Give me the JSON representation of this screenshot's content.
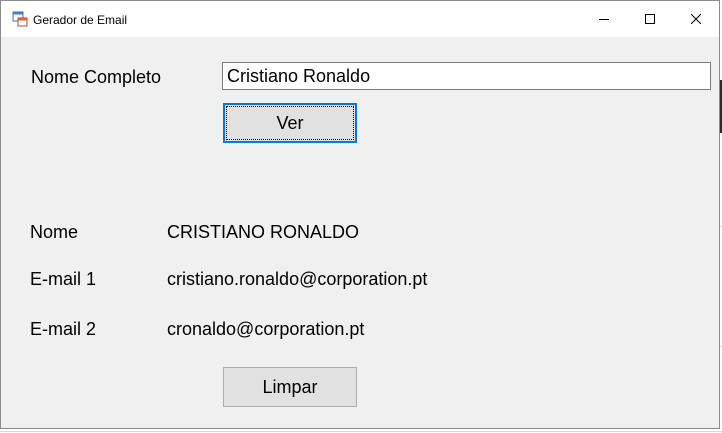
{
  "window": {
    "title": "Gerador de Email",
    "controls": [
      "minimize-icon",
      "maximize-icon",
      "close-icon"
    ]
  },
  "form": {
    "full_name_label": "Nome Completo",
    "full_name_value": "Cristiano Ronaldo",
    "view_button": "Ver",
    "clear_button": "Limpar"
  },
  "results": {
    "name_label": "Nome",
    "name_value": "CRISTIANO RONALDO",
    "email1_label": "E-mail 1",
    "email1_value": "cristiano.ronaldo@corporation.pt",
    "email2_label": "E-mail 2",
    "email2_value": "cronaldo@corporation.pt"
  },
  "colors": {
    "window_bg": "#f0f0f0",
    "titlebar_bg": "#ffffff",
    "focus_accent": "#0078d7",
    "button_bg": "#e1e1e1"
  }
}
